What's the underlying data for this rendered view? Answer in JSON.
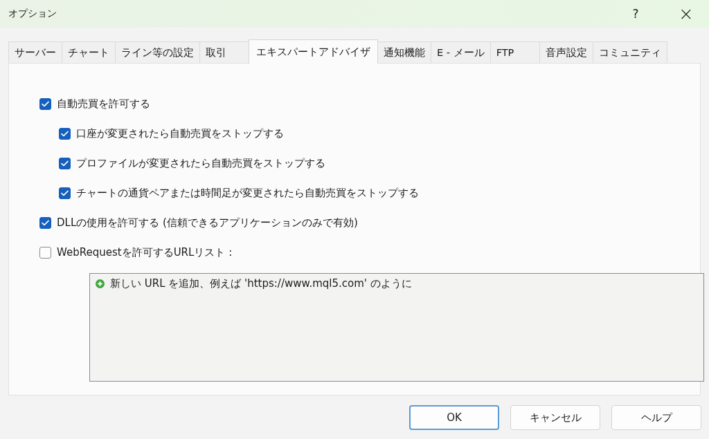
{
  "window": {
    "title": "オプション",
    "help": "?",
    "close": "×"
  },
  "tabs": [
    {
      "label": "サーバー",
      "selected": false
    },
    {
      "label": "チャート",
      "selected": false
    },
    {
      "label": "ライン等の設定",
      "selected": false
    },
    {
      "label": "取引",
      "selected": false
    },
    {
      "label": "エキスパートアドバイザ",
      "selected": true
    },
    {
      "label": "通知機能",
      "selected": false
    },
    {
      "label": "E - メール",
      "selected": false
    },
    {
      "label": "FTP",
      "selected": false
    },
    {
      "label": "音声設定",
      "selected": false
    },
    {
      "label": "コミュニティ",
      "selected": false
    }
  ],
  "options": [
    {
      "label": "自動売買を許可する",
      "checked": true,
      "children": [
        {
          "label": "口座が変更されたら自動売買をストップする",
          "checked": true
        },
        {
          "label": "プロファイルが変更されたら自動売買をストップする",
          "checked": true
        },
        {
          "label": "チャートの通貨ペアまたは時間足が変更されたら自動売買をストップする",
          "checked": true
        }
      ]
    },
    {
      "label": "DLLの使用を許可する (信頼できるアプリケーションのみで有効)",
      "checked": true
    },
    {
      "label": "WebRequestを許可するURLリスト :",
      "checked": false
    }
  ],
  "url_list": {
    "add_hint": "新しい URL を追加、例えば 'https://www.mql5.com' のように"
  },
  "buttons": [
    {
      "label": "OK",
      "default": true
    },
    {
      "label": "キャンセル",
      "default": false
    },
    {
      "label": "ヘルプ",
      "default": false
    }
  ]
}
